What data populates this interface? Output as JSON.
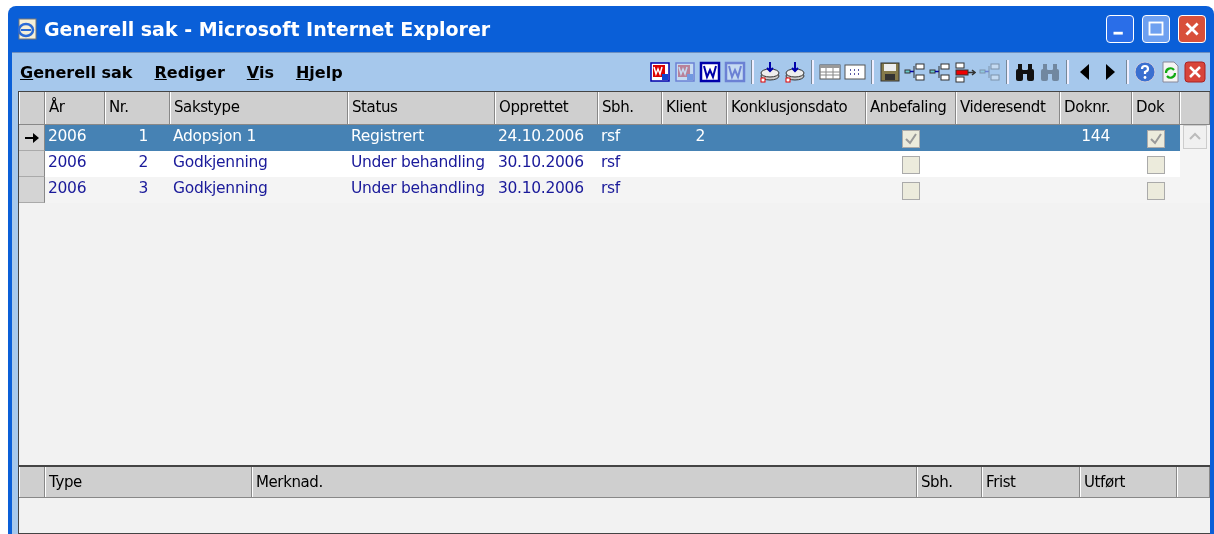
{
  "window": {
    "title": "Generell sak - Microsoft Internet Explorer"
  },
  "menu": [
    {
      "label": "Generell sak"
    },
    {
      "label": "Rediger"
    },
    {
      "label": "Vis"
    },
    {
      "label": "Hjelp"
    }
  ],
  "toolbar": [
    [
      {
        "kind": "word",
        "disabled": false
      },
      {
        "kind": "word",
        "disabled": true
      },
      {
        "kind": "word-letter",
        "disabled": false
      },
      {
        "kind": "word-letter",
        "disabled": true
      }
    ],
    [
      {
        "kind": "disk-stack",
        "disabled": false
      },
      {
        "kind": "disk-stack",
        "disabled": false
      }
    ],
    [
      {
        "kind": "table",
        "disabled": false
      },
      {
        "kind": "dots",
        "disabled": false
      }
    ],
    [
      {
        "kind": "save",
        "disabled": false
      },
      {
        "kind": "flow",
        "disabled": false
      },
      {
        "kind": "flow",
        "disabled": false
      },
      {
        "kind": "flow-red",
        "disabled": false
      },
      {
        "kind": "flow",
        "disabled": true
      }
    ],
    [
      {
        "kind": "binoculars",
        "disabled": false
      },
      {
        "kind": "binoculars",
        "disabled": true
      }
    ],
    [
      {
        "kind": "left",
        "disabled": false
      },
      {
        "kind": "right",
        "disabled": false
      }
    ],
    [
      {
        "kind": "help",
        "disabled": false
      },
      {
        "kind": "refresh",
        "disabled": false
      },
      {
        "kind": "close",
        "disabled": false
      }
    ]
  ],
  "table": {
    "columns": [
      "År",
      "Nr.",
      "Sakstype",
      "Status",
      "Opprettet",
      "Sbh.",
      "Klient",
      "Konklusjonsdato",
      "Anbefaling",
      "Videresendt",
      "Doknr.",
      "Dok"
    ],
    "rows": [
      {
        "selected": true,
        "year": "2006",
        "nr": "1",
        "sakstype": "Adopsjon 1",
        "status": "Registrert",
        "opprettet": "24.10.2006",
        "sbh": "rsf",
        "klient": "2",
        "anbefaling": true,
        "doknr": "144",
        "dok": true
      },
      {
        "selected": false,
        "year": "2006",
        "nr": "2",
        "sakstype": "Godkjenning",
        "status": "Under behandling",
        "opprettet": "30.10.2006",
        "sbh": "rsf",
        "anbefaling": false,
        "dok": false
      },
      {
        "selected": false,
        "year": "2006",
        "nr": "3",
        "sakstype": "Godkjenning",
        "status": "Under behandling",
        "opprettet": "30.10.2006",
        "sbh": "rsf",
        "anbefaling": false,
        "dok": false
      }
    ]
  },
  "notes_table": {
    "columns": [
      "Type",
      "Merknad.",
      "Sbh.",
      "Frist",
      "Utført"
    ]
  }
}
